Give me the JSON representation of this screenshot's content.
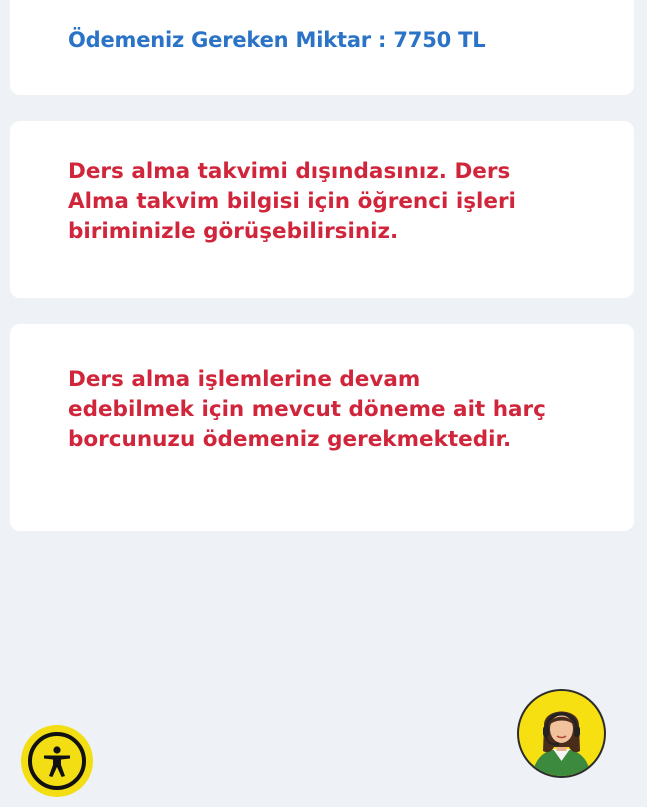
{
  "payment": {
    "label": "Ödemeniz Gereken Miktar : 7750 TL"
  },
  "warnings": [
    {
      "text": "Ders alma takvimi dışındasınız. Ders Alma takvim bilgisi için öğrenci işleri biriminizle görüşebilirsiniz."
    },
    {
      "text": "Ders alma işlemlerine devam edebilmek için mevcut döneme ait harç borcunuzu ödemeniz gerekmektedir."
    }
  ],
  "icons": {
    "accessibility": "accessibility-icon",
    "support": "support-agent-icon"
  },
  "colors": {
    "background": "#eef1f6",
    "payment_text": "#2a73c6",
    "warning_text": "#d0253a",
    "fab_yellow": "#f2de12"
  }
}
